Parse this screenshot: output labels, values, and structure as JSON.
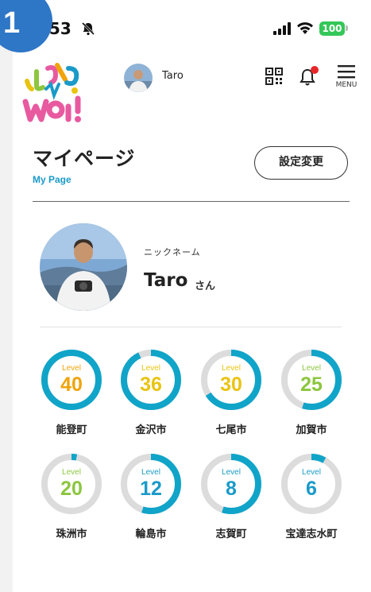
{
  "status_bar": {
    "time": "9:53",
    "battery": "100"
  },
  "step_badge": "1",
  "header": {
    "username": "Taro",
    "menu_label": "MENU"
  },
  "page": {
    "title": "マイページ",
    "subtitle": "My Page",
    "settings_button": "設定変更"
  },
  "profile": {
    "nickname_label": "ニックネーム",
    "nickname": "Taro",
    "honorific": "さん"
  },
  "levels": [
    {
      "town": "能登町",
      "label": "Level",
      "level": "40",
      "progress": 1.0,
      "color": "#f0a30a"
    },
    {
      "town": "金沢市",
      "label": "Level",
      "level": "36",
      "progress": 0.93,
      "color": "#e8c410"
    },
    {
      "town": "七尾市",
      "label": "Level",
      "level": "30",
      "progress": 0.66,
      "color": "#e8c410"
    },
    {
      "town": "加賀市",
      "label": "Level",
      "level": "25",
      "progress": 0.55,
      "color": "#8cc63f"
    },
    {
      "town": "珠洲市",
      "label": "Level",
      "level": "20",
      "progress": 0.03,
      "color": "#8cc63f"
    },
    {
      "town": "輪島市",
      "label": "Level",
      "level": "12",
      "progress": 0.55,
      "color": "#1a9ac9"
    },
    {
      "town": "志賀町",
      "label": "Level",
      "level": "8",
      "progress": 0.55,
      "color": "#1a9ac9"
    },
    {
      "town": "宝達志水町",
      "label": "Level",
      "level": "6",
      "progress": 0.08,
      "color": "#1a9ac9"
    }
  ],
  "colors": {
    "ring": "#10a4c8",
    "track": "#dcdcdc",
    "accent": "#1a9ac9",
    "badge": "#2e76c6"
  }
}
